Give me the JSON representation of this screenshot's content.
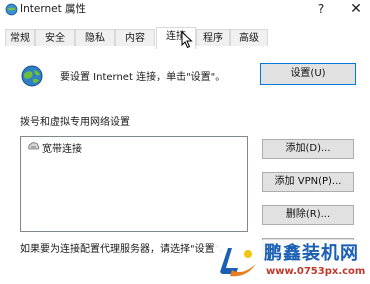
{
  "window": {
    "title": "Internet 属性",
    "help_glyph": "?",
    "close_glyph": "✕"
  },
  "tabs": [
    {
      "label": "常规",
      "active": false
    },
    {
      "label": "安全",
      "active": false
    },
    {
      "label": "隐私",
      "active": false
    },
    {
      "label": "内容",
      "active": false
    },
    {
      "label": "连接",
      "active": true
    },
    {
      "label": "程序",
      "active": false
    },
    {
      "label": "高级",
      "active": false
    }
  ],
  "connections": {
    "intro_text": "要设置 Internet 连接，单击\"设置\"。",
    "setup_button": "设置(U)",
    "dialup_section_label": "拨号和虚拟专用网络设置",
    "list_items": [
      {
        "label": "宽带连接",
        "icon": "network-connection-icon"
      }
    ],
    "add_button": "添加(D)...",
    "add_vpn_button": "添加 VPN(P)...",
    "delete_button": "删除(R)...",
    "proxy_text": "如果要为连接配置代理服务器，请选择\"设置\"。"
  },
  "watermark": {
    "brand": "鹏鑫装机网",
    "url": "www.0753px.com"
  }
}
